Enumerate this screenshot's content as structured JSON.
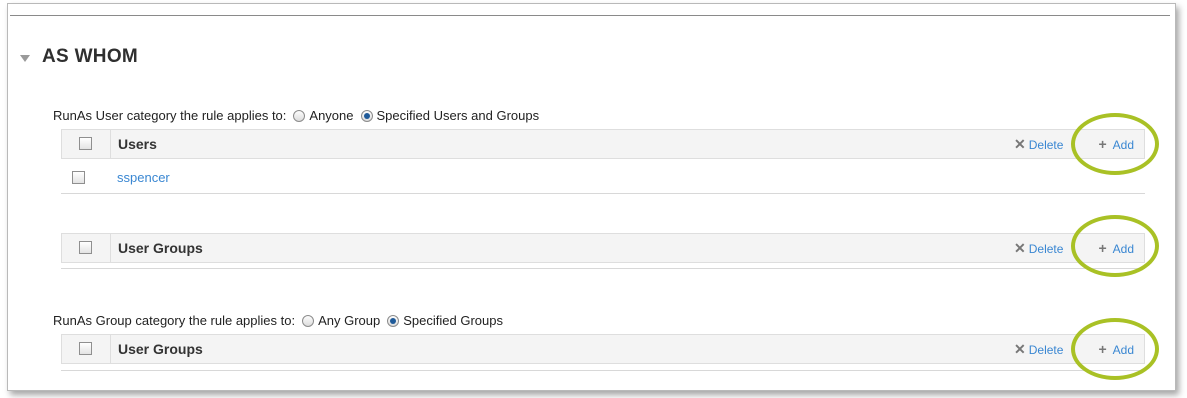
{
  "section": {
    "title": "AS WHOM"
  },
  "runas_user": {
    "label": "RunAs User category the rule applies to:",
    "options": [
      {
        "label": "Anyone",
        "checked": false
      },
      {
        "label": "Specified Users and Groups",
        "checked": true
      }
    ]
  },
  "users_table": {
    "title": "Users",
    "delete_label": "Delete",
    "add_label": "Add",
    "rows": [
      {
        "name": "sspencer"
      }
    ]
  },
  "user_groups_table": {
    "title": "User Groups",
    "delete_label": "Delete",
    "add_label": "Add"
  },
  "runas_group": {
    "label": "RunAs Group category the rule applies to:",
    "options": [
      {
        "label": "Any Group",
        "checked": false
      },
      {
        "label": "Specified Groups",
        "checked": true
      }
    ]
  },
  "group_user_groups_table": {
    "title": "User Groups",
    "delete_label": "Delete",
    "add_label": "Add"
  },
  "colors": {
    "link": "#3a87d2",
    "highlight": "#a9c125",
    "radio_selected": "#1f5a99"
  }
}
